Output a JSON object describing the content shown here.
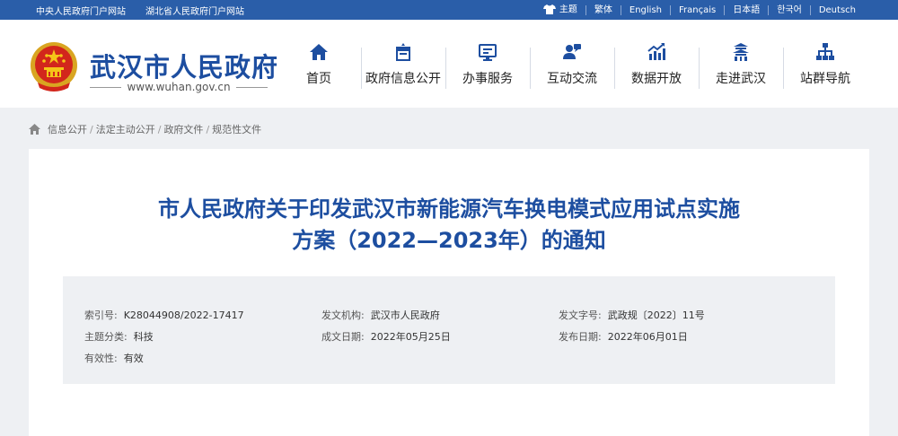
{
  "topbar": {
    "left_links": [
      "中央人民政府门户网站",
      "湖北省人民政府门户网站"
    ],
    "right_links": [
      "主题",
      "繁体",
      "English",
      "Français",
      "日本語",
      "한국어",
      "Deutsch"
    ]
  },
  "header": {
    "site_title": "武汉市人民政府",
    "site_url": "www.wuhan.gov.cn",
    "nav": [
      {
        "label": "首页",
        "icon": "home-icon"
      },
      {
        "label": "政府信息公开",
        "icon": "public-info-icon"
      },
      {
        "label": "办事服务",
        "icon": "service-monitor-icon"
      },
      {
        "label": "互动交流",
        "icon": "interaction-icon"
      },
      {
        "label": "数据开放",
        "icon": "data-chart-icon"
      },
      {
        "label": "走进武汉",
        "icon": "pavilion-icon"
      },
      {
        "label": "站群导航",
        "icon": "sitemap-icon"
      }
    ]
  },
  "breadcrumb": [
    "信息公开",
    "法定主动公开",
    "政府文件",
    "规范性文件"
  ],
  "document": {
    "title_line1": "市人民政府关于印发武汉市新能源汽车换电模式应用试点实施",
    "title_line2": "方案（2022—2023年）的通知",
    "meta": {
      "index_label": "索引号:",
      "index_value": "K28044908/2022-17417",
      "issuer_label": "发文机构:",
      "issuer_value": "武汉市人民政府",
      "docno_label": "发文字号:",
      "docno_value": "武政规〔2022〕11号",
      "topic_label": "主题分类:",
      "topic_value": "科技",
      "created_label": "成文日期:",
      "created_value": "2022年05月25日",
      "published_label": "发布日期:",
      "published_value": "2022年06月01日",
      "validity_label": "有效性:",
      "validity_value": "有效"
    }
  },
  "colors": {
    "brand_blue": "#1d4ea0",
    "topbar_blue": "#2a5ea9",
    "background": "#eef0f3"
  }
}
